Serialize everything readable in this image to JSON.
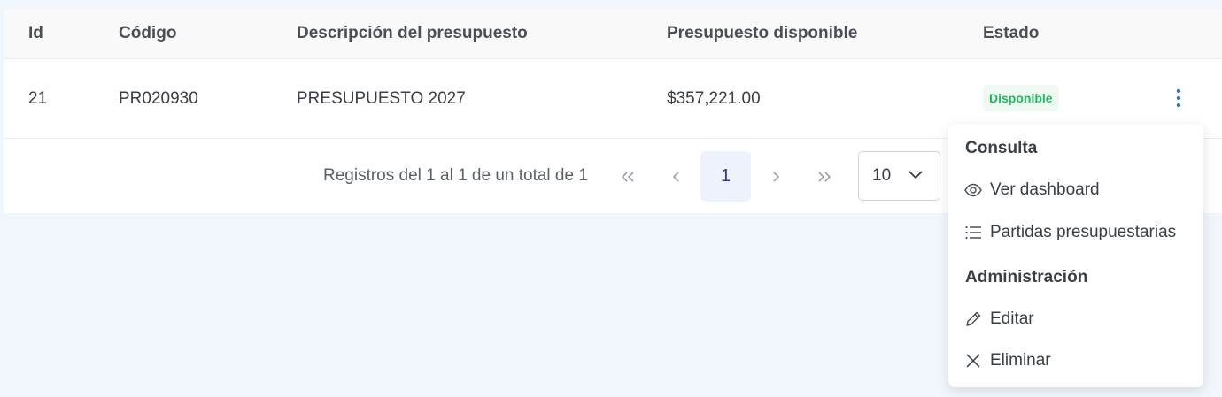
{
  "table": {
    "columns": [
      "Id",
      "Código",
      "Descripción del presupuesto",
      "Presupuesto disponible",
      "Estado"
    ],
    "rows": [
      {
        "id": "21",
        "codigo": "PR020930",
        "descripcion": "PRESUPUESTO 2027",
        "presupuesto": "$357,221.00",
        "estado": "Disponible"
      }
    ]
  },
  "pagination": {
    "info": "Registros del 1 al 1 de un total de 1",
    "current_page": "1",
    "page_size": "10"
  },
  "row_menu": {
    "section_consulta": "Consulta",
    "ver_dashboard": "Ver dashboard",
    "partidas": "Partidas presupuestarias",
    "section_admin": "Administración",
    "editar": "Editar",
    "eliminar": "Eliminar"
  },
  "colors": {
    "badge_text": "#1fbb5c",
    "badge_bg": "#eef9f1",
    "kebab": "#2e6bd1",
    "active_page_bg": "#eef2fd"
  },
  "icons": {
    "kebab": "kebab-vertical-icon",
    "ver_dashboard": "eye-icon",
    "partidas": "list-icon",
    "editar": "pencil-icon",
    "eliminar": "x-icon"
  }
}
